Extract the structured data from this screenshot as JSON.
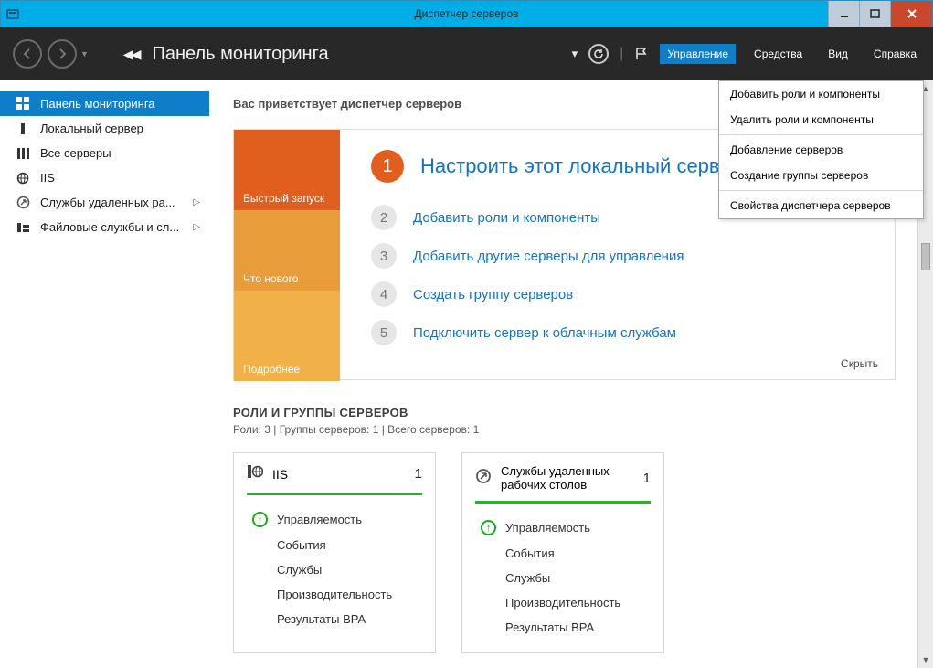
{
  "window": {
    "title": "Диспетчер серверов"
  },
  "header": {
    "heading": "Панель мониторинга",
    "menu": {
      "manage": "Управление",
      "tools": "Средства",
      "view": "Вид",
      "help": "Справка"
    }
  },
  "sidebar": {
    "items": [
      {
        "label": "Панель мониторинга"
      },
      {
        "label": "Локальный сервер"
      },
      {
        "label": "Все серверы"
      },
      {
        "label": "IIS"
      },
      {
        "label": "Службы удаленных ра..."
      },
      {
        "label": "Файловые службы и сл..."
      }
    ]
  },
  "welcome": {
    "greeting": "Вас приветствует диспетчер серверов",
    "side": {
      "quickstart": "Быстрый запуск",
      "whatsnew": "Что нового",
      "learnmore": "Подробнее"
    },
    "steps": {
      "s1": "1",
      "t1": "Настроить этот локальный серв",
      "s2": "2",
      "t2": "Добавить роли и компоненты",
      "s3": "3",
      "t3": "Добавить другие серверы для управления",
      "s4": "4",
      "t4": "Создать группу серверов",
      "s5": "5",
      "t5": "Подключить сервер к облачным службам"
    },
    "hide": "Скрыть"
  },
  "roles": {
    "title": "РОЛИ И ГРУППЫ СЕРВЕРОВ",
    "subtitle": "Роли: 3 | Группы серверов: 1 | Всего серверов: 1",
    "tiles": [
      {
        "title": "IIS",
        "count": "1",
        "rows": [
          "Управляемость",
          "События",
          "Службы",
          "Производительность",
          "Результаты BPA"
        ]
      },
      {
        "title": "Службы удаленных рабочих столов",
        "count": "1",
        "rows": [
          "Управляемость",
          "События",
          "Службы",
          "Производительность",
          "Результаты BPA"
        ]
      }
    ]
  },
  "dropdown": {
    "i1": "Добавить роли и компоненты",
    "i2": "Удалить роли и компоненты",
    "i3": "Добавление серверов",
    "i4": "Создание группы серверов",
    "i5": "Свойства диспетчера серверов"
  }
}
